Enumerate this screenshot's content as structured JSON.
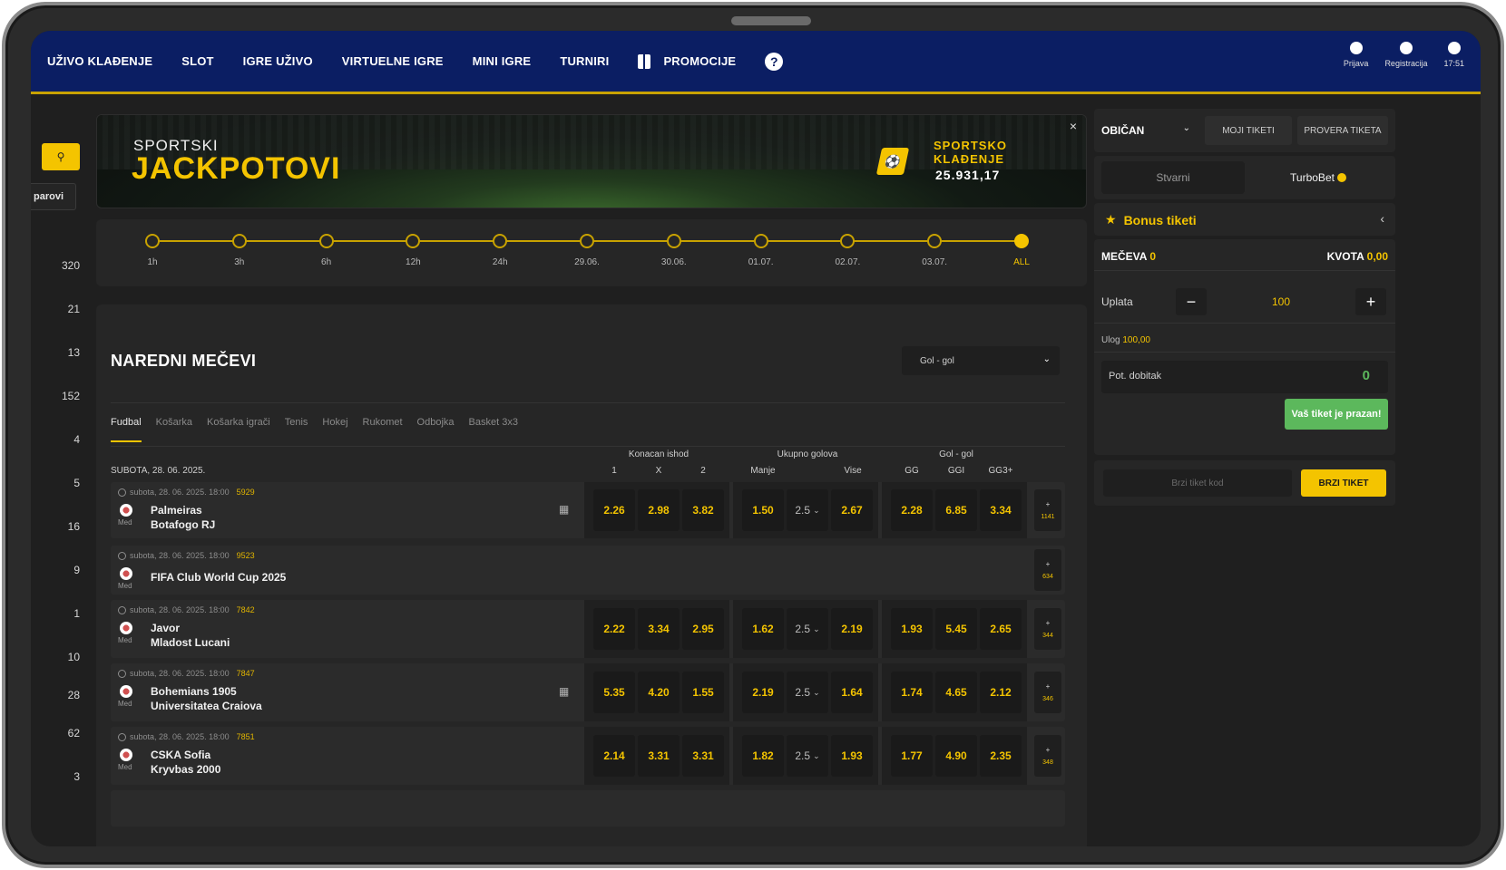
{
  "nav": {
    "items": [
      "UŽIVO KLAĐENJE",
      "SLOT",
      "IGRE UŽIVO",
      "VIRTUELNE IGRE",
      "MINI IGRE",
      "TURNIRI",
      "PROMOCIJE"
    ],
    "help_label": "?",
    "right": {
      "login": "Prijava",
      "register": "Registracija",
      "time": "17:51"
    }
  },
  "left": {
    "search_icon": "search-icon",
    "parovi_label": "parovi",
    "counts": [
      "320",
      "21",
      "13",
      "152",
      "4",
      "5",
      "16",
      "9",
      "1",
      "10",
      "28",
      "62",
      "3"
    ]
  },
  "banner": {
    "subtitle": "SPORTSKI",
    "title": "JACKPOTOVI",
    "right_label_1": "SPORTSKO",
    "right_label_2": "KLAĐENJE",
    "amount": "25.931,17",
    "close": "×"
  },
  "timeline": {
    "labels": [
      "1h",
      "3h",
      "6h",
      "12h",
      "24h",
      "29.06.",
      "30.06.",
      "01.07.",
      "02.07.",
      "03.07.",
      "ALL"
    ],
    "active_index": 10
  },
  "main": {
    "title": "NAREDNI MEČEVI",
    "select_value": "Gol - gol",
    "tabs": [
      "Fudbal",
      "Košarka",
      "Košarka igrači",
      "Tenis",
      "Hokej",
      "Rukomet",
      "Odbojka",
      "Basket 3x3"
    ],
    "active_tab": 0,
    "date_label": "SUBOTA, 28. 06. 2025.",
    "groups": {
      "g1": "Konacan ishod",
      "g2": "Ukupno golova",
      "g3": "Gol - gol"
    },
    "columns": {
      "c1": "1",
      "cx": "X",
      "c2": "2",
      "under": "Manje",
      "over": "Vise",
      "gg": "GG",
      "ggi": "GGI",
      "gg3": "GG3+"
    },
    "matches": [
      {
        "meta": "subota, 28. 06. 2025. 18:00",
        "code": "5929",
        "league": "Med",
        "home": "Palmeiras",
        "away": "Botafogo RJ",
        "live": true,
        "odds": [
          "2.26",
          "2.98",
          "3.82",
          "1.50",
          "2.5",
          "2.67",
          "2.28",
          "6.85",
          "3.34"
        ],
        "more": "1141"
      },
      {
        "meta": "subota, 28. 06. 2025. 18:00",
        "code": "9523",
        "league": "Med",
        "home": "FIFA Club World Cup 2025",
        "away": "",
        "live": false,
        "odds": [],
        "more": "634"
      },
      {
        "meta": "subota, 28. 06. 2025. 18:00",
        "code": "7842",
        "league": "Med",
        "home": "Javor",
        "away": "Mladost Lucani",
        "live": false,
        "odds": [
          "2.22",
          "3.34",
          "2.95",
          "1.62",
          "2.5",
          "2.19",
          "1.93",
          "5.45",
          "2.65"
        ],
        "more": "344"
      },
      {
        "meta": "subota, 28. 06. 2025. 18:00",
        "code": "7847",
        "league": "Med",
        "home": "Bohemians 1905",
        "away": "Universitatea Craiova",
        "live": true,
        "odds": [
          "5.35",
          "4.20",
          "1.55",
          "2.19",
          "2.5",
          "1.64",
          "1.74",
          "4.65",
          "2.12"
        ],
        "more": "346"
      },
      {
        "meta": "subota, 28. 06. 2025. 18:00",
        "code": "7851",
        "league": "Med",
        "home": "CSKA Sofia",
        "away": "Kryvbas 2000",
        "live": false,
        "odds": [
          "2.14",
          "3.31",
          "3.31",
          "1.82",
          "2.5",
          "1.93",
          "1.77",
          "4.90",
          "2.35"
        ],
        "more": "348"
      }
    ]
  },
  "ticket": {
    "type": "OBIČAN",
    "my_tickets": "MOJI TIKETI",
    "check_ticket": "PROVERA TIKETA",
    "toggle_real": "Stvarni",
    "toggle_turbo": "TurboBet",
    "bonus": "Bonus tiketi",
    "matches_label": "MEČEVA",
    "matches_value": "0",
    "odds_label": "KVOTA",
    "odds_value": "0,00",
    "stake_label": "Uplata",
    "stake_value": "100",
    "ulog_label": "Ulog",
    "ulog_value": "100,00",
    "potential_label": "Pot. dobitak",
    "potential_value": "0",
    "empty_button": "Vaš tiket je prazan!",
    "quick_placeholder": "Brzi tiket kod",
    "quick_button": "BRZI TIKET"
  },
  "colors": {
    "accent": "#f4c400",
    "nav_bg": "#0b1e63",
    "green": "#5cb85c"
  }
}
